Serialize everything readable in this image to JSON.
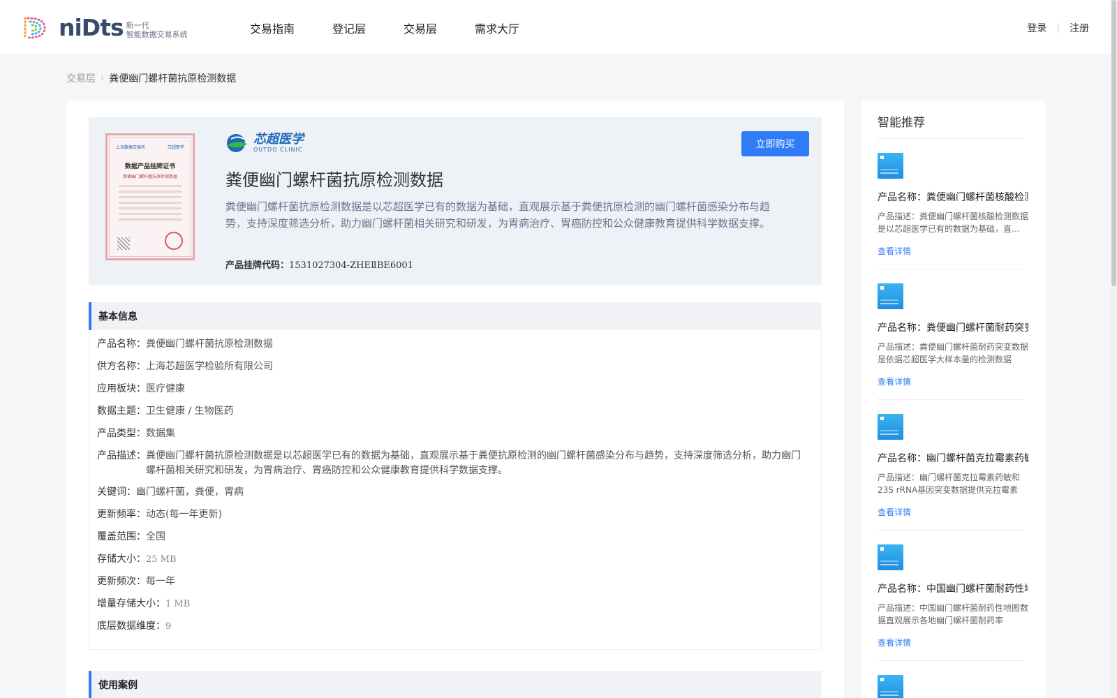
{
  "header": {
    "logo_word": "niDts",
    "logo_sub1": "新一代",
    "logo_sub2": "智能数据交易系统",
    "nav": [
      "交易指南",
      "登记层",
      "交易层",
      "需求大厅"
    ],
    "login": "登录",
    "register": "注册"
  },
  "breadcrumb": {
    "parent": "交易层",
    "current": "粪便幽门螺杆菌抗原检测数据"
  },
  "hero": {
    "cert": {
      "org1": "上海数据交易所",
      "org2": "芯超医学",
      "title": "数据产品挂牌证书",
      "subtitle": "粪便幽门螺杆菌抗原检测数据"
    },
    "brand_cn": "芯超医学",
    "brand_en": "OUTDO CLINIC",
    "buy_label": "立即购买",
    "title": "粪便幽门螺杆菌抗原检测数据",
    "description": "粪便幽门螺杆菌抗原检测数据是以芯超医学已有的数据为基础，直观展示基于粪便抗原检测的幽门螺杆菌感染分布与趋势，支持深度筛选分析，助力幽门螺杆菌相关研究和研发，为胃病治疗、胃癌防控和公众健康教育提供科学数据支撑。",
    "code_label": "产品挂牌代码：",
    "code_value": "1531027304-ZHEⅡBE6001"
  },
  "basic": {
    "section_title": "基本信息",
    "rows": [
      {
        "k": "产品名称：",
        "v": "粪便幽门螺杆菌抗原检测数据"
      },
      {
        "k": "供方名称：",
        "v": "上海芯超医学检验所有限公司"
      },
      {
        "k": "应用板块：",
        "v": "医疗健康"
      },
      {
        "k": "数据主题：",
        "v": "卫生健康 / 生物医药"
      },
      {
        "k": "产品类型：",
        "v": "数据集"
      },
      {
        "k": "产品描述：",
        "v": "粪便幽门螺杆菌抗原检测数据是以芯超医学已有的数据为基础，直观展示基于粪便抗原检测的幽门螺杆菌感染分布与趋势，支持深度筛选分析，助力幽门螺杆菌相关研究和研发，为胃病治疗、胃癌防控和公众健康教育提供科学数据支撑。"
      },
      {
        "k": "关键词：",
        "v": "幽门螺杆菌，粪便，胃病"
      },
      {
        "k": "更新频率：",
        "v": "动态(每一年更新)"
      },
      {
        "k": "覆盖范围：",
        "v": "全国"
      },
      {
        "k": "存储大小：",
        "v": "25 MB"
      },
      {
        "k": "更新频次：",
        "v": "每一年"
      },
      {
        "k": "增量存储大小：",
        "v": "1 MB"
      },
      {
        "k": "底层数据维度：",
        "v": "9"
      }
    ]
  },
  "usecase": {
    "section_title": "使用案例"
  },
  "sidebar": {
    "title": "智能推荐",
    "items": [
      {
        "name": "产品名称：粪便幽门螺杆菌核酸检测数据",
        "desc": "产品描述：粪便幽门螺杆菌核酸检测数据是以芯超医学已有的数据为基础，直观展示",
        "link": "查看详情"
      },
      {
        "name": "产品名称：粪便幽门螺杆菌耐药突变数据",
        "desc": "产品描述：粪便幽门螺杆菌耐药突变数据是依据芯超医学大样本量的检测数据",
        "link": "查看详情"
      },
      {
        "name": "产品名称：幽门螺杆菌克拉霉素药敏数据",
        "desc": "产品描述：幽门螺杆菌克拉霉素药敏和23S rRNA基因突变数据提供克拉霉素",
        "link": "查看详情"
      },
      {
        "name": "产品名称：中国幽门螺杆菌耐药性地图数据",
        "desc": "产品描述：中国幽门螺杆菌耐药性地图数据直观展示各地幽门螺杆菌耐药率",
        "link": "查看详情"
      }
    ]
  }
}
